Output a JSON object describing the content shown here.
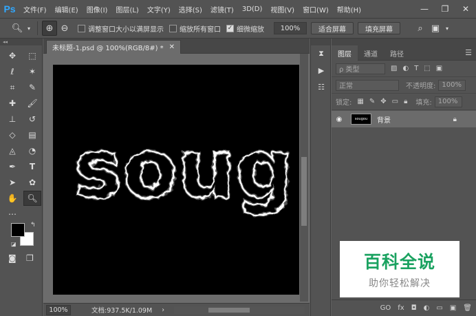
{
  "app": {
    "logo": "Ps"
  },
  "menu": [
    "文件(F)",
    "编辑(E)",
    "图像(I)",
    "图层(L)",
    "文字(Y)",
    "选择(S)",
    "滤镜(T)",
    "3D(D)",
    "视图(V)",
    "窗口(W)",
    "帮助(H)"
  ],
  "window_controls": {
    "minimize": "—",
    "restore": "❐",
    "close": "✕"
  },
  "options": {
    "resize_windows": "调整窗口大小以满屏显示",
    "zoom_all": "缩放所有窗口",
    "scrubby_zoom": "细微缩放",
    "zoom_value": "100%",
    "fit_screen": "适合屏幕",
    "fill_screen": "填充屏幕"
  },
  "document": {
    "tab_title": "未标题-1.psd @ 100%(RGB/8#) *",
    "canvas_text": "soug"
  },
  "status": {
    "zoom": "100%",
    "doc_size": "文档:937.5K/1.09M"
  },
  "layers_panel": {
    "tabs": [
      "图层",
      "通道",
      "路径"
    ],
    "filter_label": "ρ 类型",
    "blend_mode": "正常",
    "opacity_label": "不透明度:",
    "opacity_value": "100%",
    "lock_label": "锁定:",
    "fill_label": "填充:",
    "fill_value": "100%",
    "layer_name": "背景",
    "thumb_text": "sougou",
    "footer": [
      "GO",
      "fx",
      "◘",
      "◐",
      "▭",
      "▣",
      "🗑"
    ]
  },
  "watermark": {
    "title": "百科全说",
    "subtitle": "助你轻松解决"
  },
  "colors": {
    "accent": "#31a8ff",
    "watermark_green": "#1aa260"
  }
}
